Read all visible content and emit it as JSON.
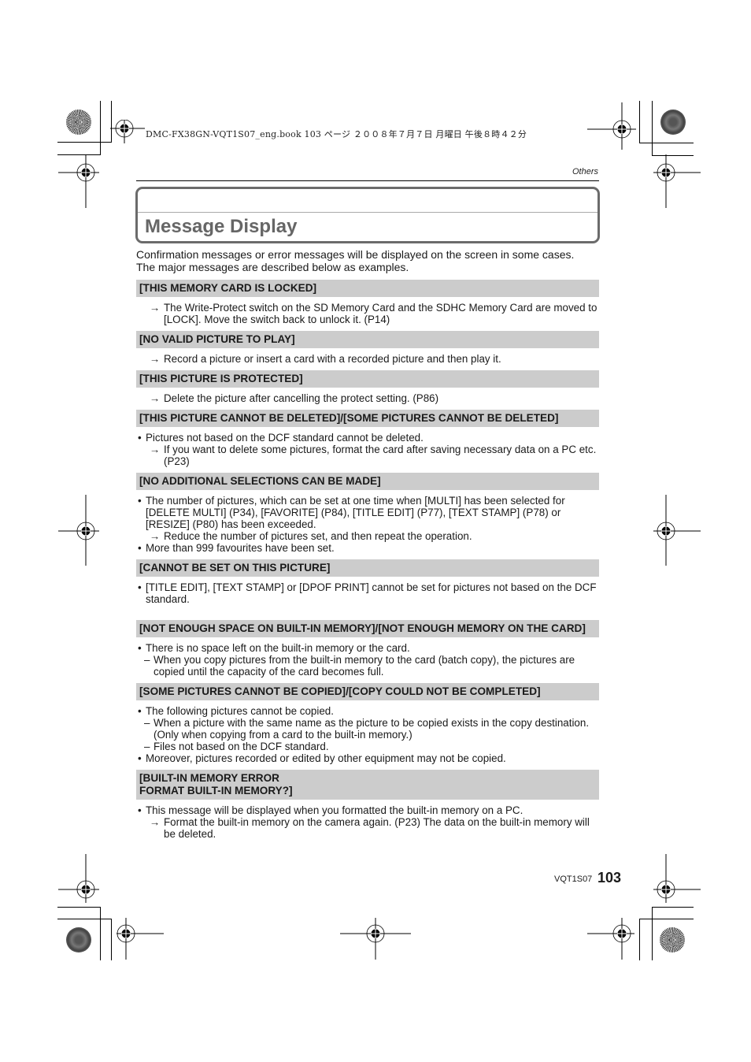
{
  "print_header": "DMC-FX38GN-VQT1S07_eng.book   103 ページ   ２００８年７月７日   月曜日   午後８時４２分",
  "section_label": "Others",
  "page_title": "Message Display",
  "intro": [
    "Confirmation messages or error messages will be displayed on the screen in some cases.",
    "The major messages are described below as examples."
  ],
  "messages": [
    {
      "heading": "[THIS MEMORY CARD IS LOCKED]",
      "lines": [
        {
          "type": "arrow",
          "text": "The Write-Protect switch on the SD Memory Card and the SDHC Memory Card are moved to [LOCK]. Move the switch back to unlock it. (P14)"
        }
      ]
    },
    {
      "heading": "[NO VALID PICTURE TO PLAY]",
      "lines": [
        {
          "type": "arrow",
          "text": "Record a picture or insert a card with a recorded picture and then play it."
        }
      ]
    },
    {
      "heading": "[THIS PICTURE IS PROTECTED]",
      "lines": [
        {
          "type": "arrow",
          "text": "Delete the picture after cancelling the protect setting. (P86)"
        }
      ]
    },
    {
      "heading": "[THIS PICTURE CANNOT BE DELETED]/[SOME PICTURES CANNOT BE DELETED]",
      "lines": [
        {
          "type": "bullet",
          "text": "Pictures not based on the DCF standard cannot be deleted."
        },
        {
          "type": "arrow",
          "text": "If you want to delete some pictures, format the card after saving necessary data on a PC etc. (P23)"
        }
      ]
    },
    {
      "heading": "[NO ADDITIONAL SELECTIONS CAN BE MADE]",
      "lines": [
        {
          "type": "bullet",
          "text": "The number of pictures, which can be set at one time when [MULTI] has been selected for [DELETE MULTI] (P34), [FAVORITE] (P84), [TITLE EDIT] (P77), [TEXT STAMP] (P78) or [RESIZE] (P80) has been exceeded."
        },
        {
          "type": "arrow",
          "text": "Reduce the number of pictures set, and then repeat the operation."
        },
        {
          "type": "bullet",
          "text": "More than 999 favourites have been set."
        }
      ]
    },
    {
      "heading": "[CANNOT BE SET ON THIS PICTURE]",
      "lines": [
        {
          "type": "bullet",
          "text": "[TITLE EDIT], [TEXT STAMP] or [DPOF PRINT] cannot be set for pictures not based on the DCF standard."
        }
      ]
    },
    {
      "heading": "[NOT ENOUGH SPACE ON BUILT-IN MEMORY]/[NOT ENOUGH MEMORY ON THE CARD]",
      "lines": [
        {
          "type": "bullet",
          "text": "There is no space left on the built-in memory or the card."
        },
        {
          "type": "dash",
          "text": "When you copy pictures from the built-in memory to the card (batch copy), the pictures are copied until the capacity of the card becomes full."
        }
      ]
    },
    {
      "heading": "[SOME PICTURES CANNOT BE COPIED]/[COPY COULD NOT BE COMPLETED]",
      "lines": [
        {
          "type": "bullet",
          "text": "The following pictures cannot be copied."
        },
        {
          "type": "dash",
          "text": "When a picture with the same name as the picture to be copied exists in the copy destination. (Only when copying from a card to the built-in memory.)"
        },
        {
          "type": "dash",
          "text": "Files not based on the DCF standard."
        },
        {
          "type": "bullet",
          "text": "Moreover, pictures recorded or edited by other equipment may not be copied."
        }
      ]
    },
    {
      "heading": "[BUILT-IN MEMORY ERROR\nFORMAT BUILT-IN MEMORY?]",
      "heading_lines": [
        "[BUILT-IN MEMORY ERROR",
        "FORMAT BUILT-IN MEMORY?]"
      ],
      "lines": [
        {
          "type": "bullet",
          "text": "This message will be displayed when you formatted the built-in memory on a PC."
        },
        {
          "type": "arrow",
          "text": "Format the built-in memory on the camera again. (P23) The data on the built-in memory will be deleted."
        }
      ]
    }
  ],
  "glyphs": {
    "arrow": "→",
    "bullet": "•",
    "dash": "–"
  },
  "footer": {
    "model_code": "VQT1S07",
    "page_number": "103"
  }
}
